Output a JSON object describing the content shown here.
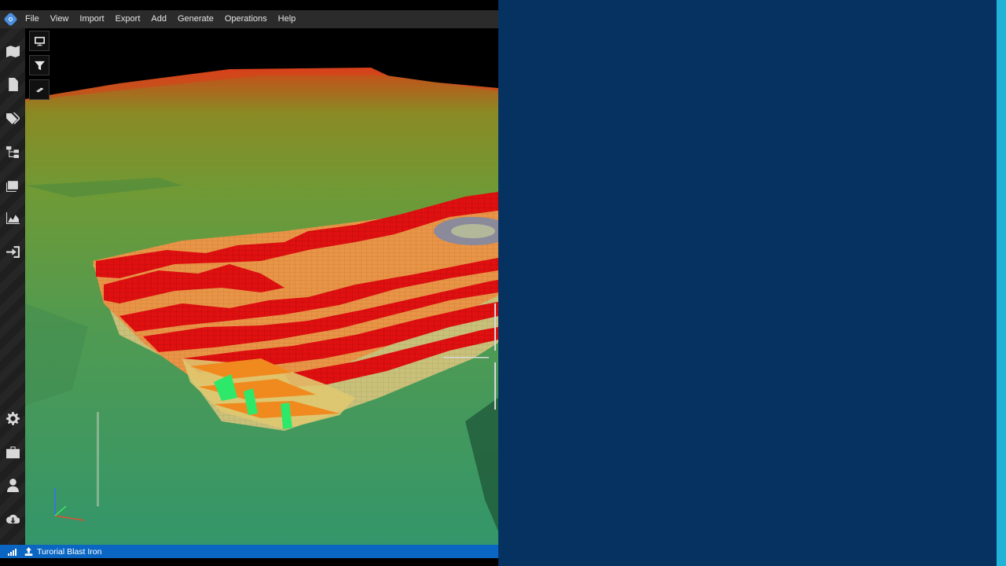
{
  "app": {
    "menu": [
      "File",
      "View",
      "Import",
      "Export",
      "Add",
      "Generate",
      "Operations",
      "Help"
    ]
  },
  "rail": {
    "top_icons": [
      "map-icon",
      "document-icon",
      "tags-icon",
      "hierarchy-icon",
      "layers-icon",
      "area-chart-icon",
      "sign-in-icon"
    ],
    "bottom_icons": [
      "gear-icon",
      "toolbox-icon",
      "user-icon",
      "cloud-download-icon"
    ]
  },
  "viewport_tools": [
    "monitor-icon",
    "filter-icon",
    "ruler-icon"
  ],
  "status": {
    "project_name": "Turorial Blast Iron"
  },
  "colors": {
    "statusbar": "#0a66c2",
    "right_panel": "#053261",
    "accent": "#1fb3d8",
    "blocks_high": "#e01010",
    "blocks_mid": "#f08a1e",
    "blocks_low": "#d7d96a",
    "blocks_green": "#2ee86a",
    "terrain": "#3f9a6a"
  }
}
